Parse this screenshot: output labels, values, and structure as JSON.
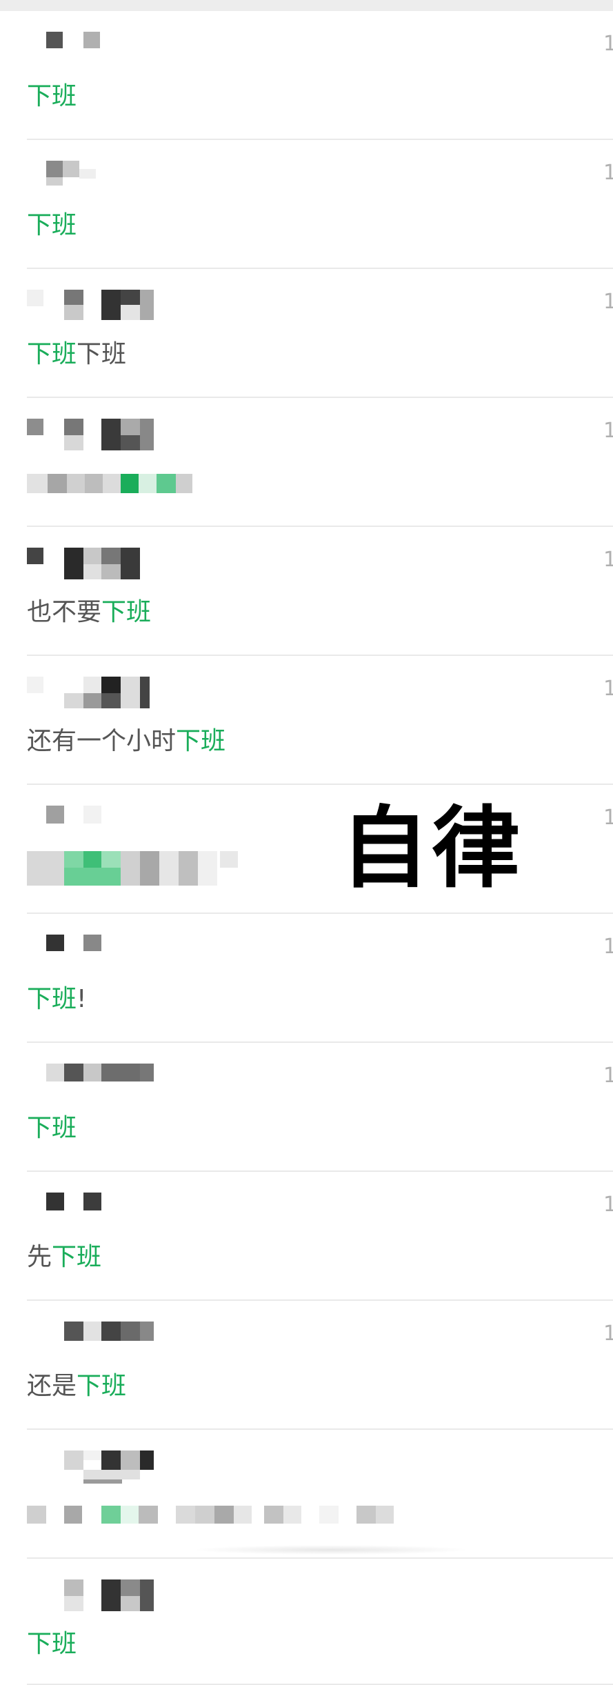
{
  "overlay_text": "自律",
  "accent_color": "#1aad5a",
  "chats": [
    {
      "time": "1",
      "message_parts": [
        {
          "text": "下班",
          "highlight": true
        }
      ]
    },
    {
      "time": "1",
      "message_parts": [
        {
          "text": "下班",
          "highlight": true
        }
      ]
    },
    {
      "time": "1",
      "message_parts": [
        {
          "text": "下班",
          "highlight": true
        },
        {
          "text": "下班",
          "highlight": false
        }
      ]
    },
    {
      "time": "1",
      "message_parts": [],
      "message_obscured": true
    },
    {
      "time": "1",
      "message_parts": [
        {
          "text": "也不要",
          "highlight": false
        },
        {
          "text": "下班",
          "highlight": true
        }
      ]
    },
    {
      "time": "1",
      "message_parts": [
        {
          "text": "还有一个小时",
          "highlight": false
        },
        {
          "text": "下班",
          "highlight": true
        }
      ]
    },
    {
      "time": "1",
      "message_parts": [],
      "message_obscured": true
    },
    {
      "time": "1",
      "message_parts": [
        {
          "text": "下班",
          "highlight": true
        },
        {
          "text": "!",
          "highlight": false
        }
      ]
    },
    {
      "time": "1",
      "message_parts": [
        {
          "text": "下班",
          "highlight": true
        }
      ]
    },
    {
      "time": "1",
      "message_parts": [
        {
          "text": "先",
          "highlight": false
        },
        {
          "text": "下班",
          "highlight": true
        }
      ]
    },
    {
      "time": "1",
      "message_parts": [
        {
          "text": "还是",
          "highlight": false
        },
        {
          "text": "下班",
          "highlight": true
        }
      ]
    },
    {
      "time": "",
      "message_parts": [],
      "message_obscured": true
    },
    {
      "time": "",
      "message_parts": [
        {
          "text": "下班",
          "highlight": true
        }
      ]
    }
  ]
}
